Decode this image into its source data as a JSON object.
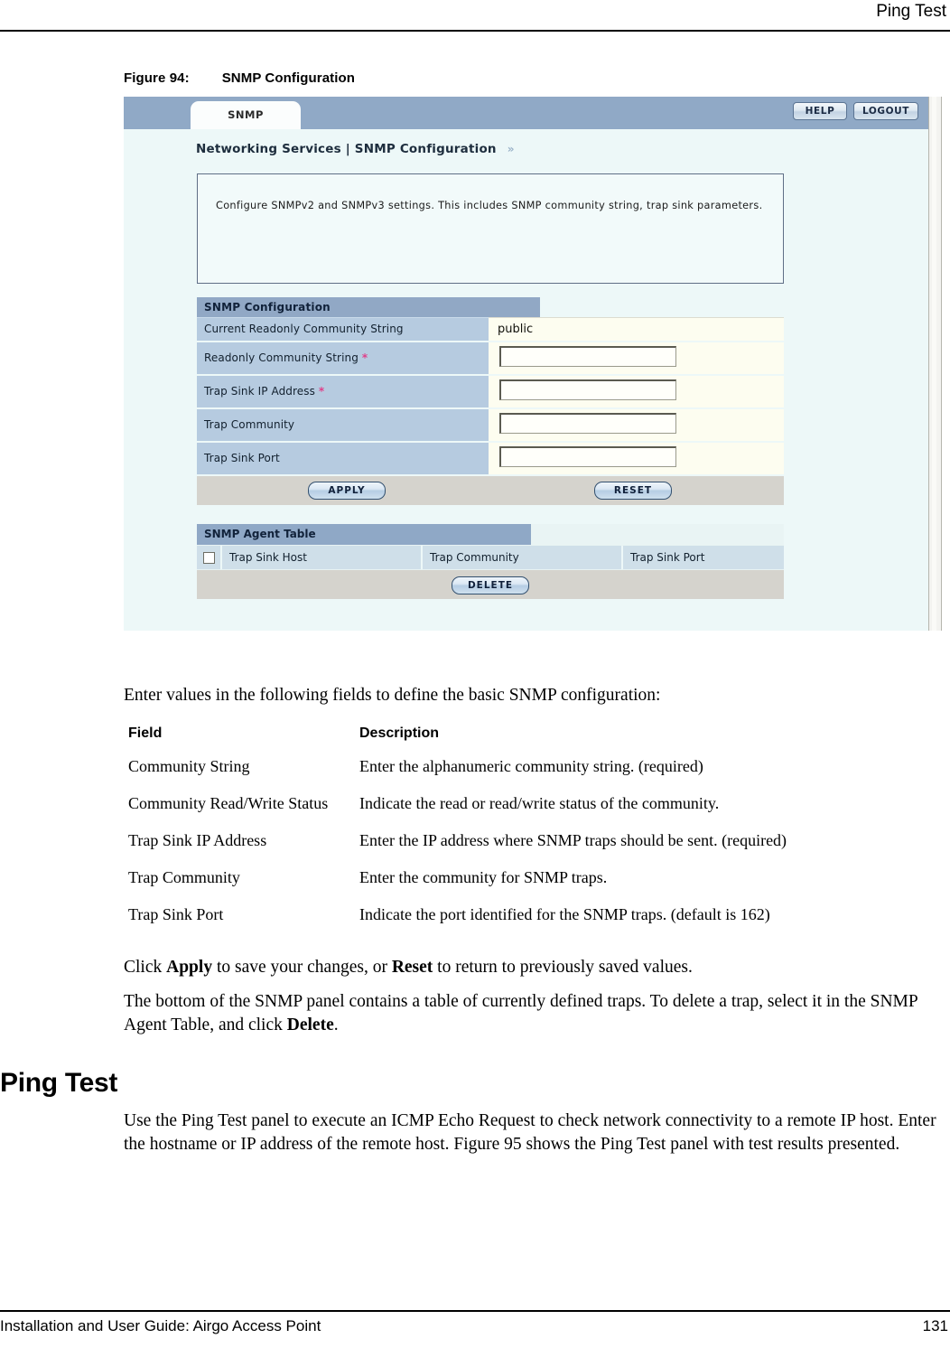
{
  "page": {
    "running_header": "Ping Test",
    "footer_left": "Installation and User Guide: Airgo Access Point",
    "footer_page_number": "131"
  },
  "figure": {
    "caption_number": "Figure 94:",
    "caption_title": "SNMP Configuration",
    "app": {
      "tab_label": "SNMP",
      "help_button": "HELP",
      "logout_button": "LOGOUT",
      "breadcrumb": "Networking Services | SNMP Configuration",
      "breadcrumb_chevron": "»",
      "description": "Configure SNMPv2 and SNMPv3 settings. This includes SNMP community string, trap sink parameters.",
      "config_panel": {
        "title": "SNMP Configuration",
        "rows": [
          {
            "label": "Current Readonly Community String",
            "required": "",
            "type": "text",
            "value": "public"
          },
          {
            "label": "Readonly Community String",
            "required": "*",
            "type": "input",
            "value": ""
          },
          {
            "label": "Trap Sink IP Address",
            "required": "*",
            "type": "input",
            "value": ""
          },
          {
            "label": "Trap Community",
            "required": "",
            "type": "input",
            "value": ""
          },
          {
            "label": "Trap Sink Port",
            "required": "",
            "type": "input",
            "value": ""
          }
        ],
        "apply_button": "APPLY",
        "reset_button": "RESET"
      },
      "agent_table": {
        "title": "SNMP Agent Table",
        "columns": [
          "Trap Sink Host",
          "Trap Community",
          "Trap Sink Port"
        ],
        "rows": [],
        "delete_button": "DELETE",
        "select_all_checked": false
      },
      "colors": {
        "tabbar_blue": "#90a9c6",
        "panel_background": "#edf8f8",
        "label_cell_blue": "#b6cbe0",
        "value_cell_cream": "#fdfdf0",
        "button_row_gray": "#d5d3cd",
        "required_asterisk": "#e0408a"
      }
    }
  },
  "body": {
    "intro_paragraph": "Enter values in the following fields to define the basic SNMP configuration:",
    "table": {
      "headers": [
        "Field",
        "Description"
      ],
      "rows": [
        {
          "field": "Community String",
          "description": "Enter the alphanumeric community string. (required)"
        },
        {
          "field": "Community Read/Write Status",
          "description": "Indicate the read or read/write status of the community."
        },
        {
          "field": "Trap Sink IP Address",
          "description": "Enter the IP address where SNMP traps should be sent. (required)"
        },
        {
          "field": "Trap Community",
          "description": "Enter the community for SNMP traps."
        },
        {
          "field": "Trap Sink Port",
          "description": "Indicate the port identified for the SNMP traps. (default is 162)"
        }
      ]
    },
    "apply_paragraph": {
      "part1": "Click ",
      "bold1": "Apply",
      "part2": " to save your changes, or ",
      "bold2": "Reset",
      "part3": " to return to previously saved values."
    },
    "bottom_paragraph": {
      "part1": "The bottom of the SNMP panel contains a table of currently defined traps. To delete a trap, select it in the SNMP Agent Table, and click ",
      "bold1": "Delete",
      "part2": "."
    },
    "ping_section": {
      "heading": "Ping Test",
      "paragraph": "Use the Ping Test panel to execute an ICMP Echo Request to check network connectivity to a remote IP host. Enter the hostname or IP address of the remote host. Figure 95 shows the Ping Test panel with test results presented."
    }
  }
}
